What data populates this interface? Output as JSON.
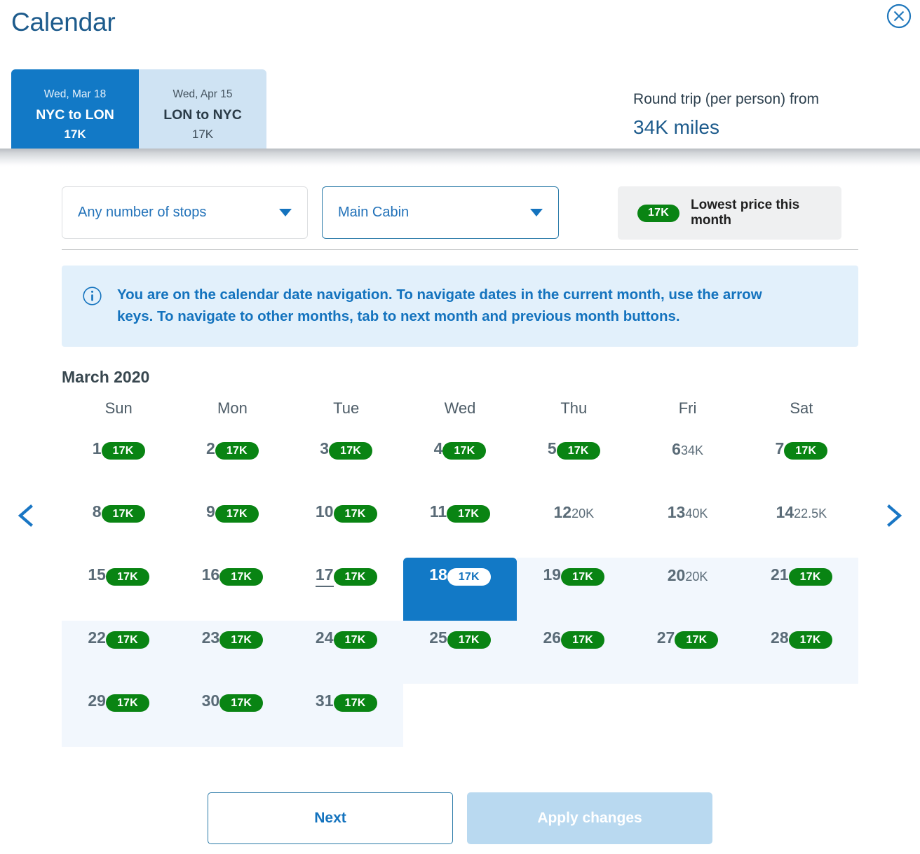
{
  "header": {
    "title": "Calendar",
    "close_icon": "close-circle-icon",
    "tabs": [
      {
        "date": "Wed, Mar 18",
        "route": "NYC to LON",
        "price": "17K",
        "active": true
      },
      {
        "date": "Wed, Apr 15",
        "route": "LON to NYC",
        "price": "17K",
        "active": false
      }
    ],
    "trip_summary": {
      "label": "Round trip (per person) from",
      "value": "34K miles"
    }
  },
  "filters": {
    "stops": {
      "value": "Any number of stops",
      "icon": "chevron-down-icon"
    },
    "cabin": {
      "value": "Main Cabin",
      "icon": "chevron-down-icon"
    },
    "legend": {
      "pill": "17K",
      "text": "Lowest price this month"
    }
  },
  "info_banner": {
    "icon": "info-circle-icon",
    "text": "You are on the calendar date navigation. To navigate dates in the current month, use the arrow keys. To navigate to other months, tab to next month and previous month buttons."
  },
  "calendar": {
    "month_title": "March 2020",
    "prev_icon": "chevron-left-icon",
    "next_icon": "chevron-right-icon",
    "weekday_headers": [
      "Sun",
      "Mon",
      "Tue",
      "Wed",
      "Thu",
      "Fri",
      "Sat"
    ],
    "selected_day": 18,
    "today_day": 17,
    "range_start_day": 18,
    "colors": {
      "lowest_price_green": "#098413",
      "selected_blue": "#1279c6",
      "range_highlight": "#f2f7fd",
      "accent_blue": "#1473be"
    },
    "weeks": [
      [
        {
          "day": "1",
          "price": "17K",
          "lowest": true
        },
        {
          "day": "2",
          "price": "17K",
          "lowest": true
        },
        {
          "day": "3",
          "price": "17K",
          "lowest": true
        },
        {
          "day": "4",
          "price": "17K",
          "lowest": true
        },
        {
          "day": "5",
          "price": "17K",
          "lowest": true
        },
        {
          "day": "6",
          "price": "34K",
          "lowest": false
        },
        {
          "day": "7",
          "price": "17K",
          "lowest": true
        }
      ],
      [
        {
          "day": "8",
          "price": "17K",
          "lowest": true
        },
        {
          "day": "9",
          "price": "17K",
          "lowest": true
        },
        {
          "day": "10",
          "price": "17K",
          "lowest": true
        },
        {
          "day": "11",
          "price": "17K",
          "lowest": true
        },
        {
          "day": "12",
          "price": "20K",
          "lowest": false
        },
        {
          "day": "13",
          "price": "40K",
          "lowest": false
        },
        {
          "day": "14",
          "price": "22.5K",
          "lowest": false
        }
      ],
      [
        {
          "day": "15",
          "price": "17K",
          "lowest": true
        },
        {
          "day": "16",
          "price": "17K",
          "lowest": true
        },
        {
          "day": "17",
          "price": "17K",
          "lowest": true,
          "today": true
        },
        {
          "day": "18",
          "price": "17K",
          "lowest": true,
          "selected": true
        },
        {
          "day": "19",
          "price": "17K",
          "lowest": true,
          "in_range": true
        },
        {
          "day": "20",
          "price": "20K",
          "lowest": false,
          "in_range": true
        },
        {
          "day": "21",
          "price": "17K",
          "lowest": true,
          "in_range": true
        }
      ],
      [
        {
          "day": "22",
          "price": "17K",
          "lowest": true,
          "in_range": true
        },
        {
          "day": "23",
          "price": "17K",
          "lowest": true,
          "in_range": true
        },
        {
          "day": "24",
          "price": "17K",
          "lowest": true,
          "in_range": true
        },
        {
          "day": "25",
          "price": "17K",
          "lowest": true,
          "in_range": true
        },
        {
          "day": "26",
          "price": "17K",
          "lowest": true,
          "in_range": true
        },
        {
          "day": "27",
          "price": "17K",
          "lowest": true,
          "in_range": true
        },
        {
          "day": "28",
          "price": "17K",
          "lowest": true,
          "in_range": true
        }
      ],
      [
        {
          "day": "29",
          "price": "17K",
          "lowest": true,
          "in_range": true
        },
        {
          "day": "30",
          "price": "17K",
          "lowest": true,
          "in_range": true
        },
        {
          "day": "31",
          "price": "17K",
          "lowest": true,
          "in_range": true
        },
        {
          "day": "",
          "price": "",
          "empty": true
        },
        {
          "day": "",
          "price": "",
          "empty": true
        },
        {
          "day": "",
          "price": "",
          "empty": true
        },
        {
          "day": "",
          "price": "",
          "empty": true
        }
      ]
    ]
  },
  "footer": {
    "next_label": "Next",
    "apply_label": "Apply changes"
  }
}
